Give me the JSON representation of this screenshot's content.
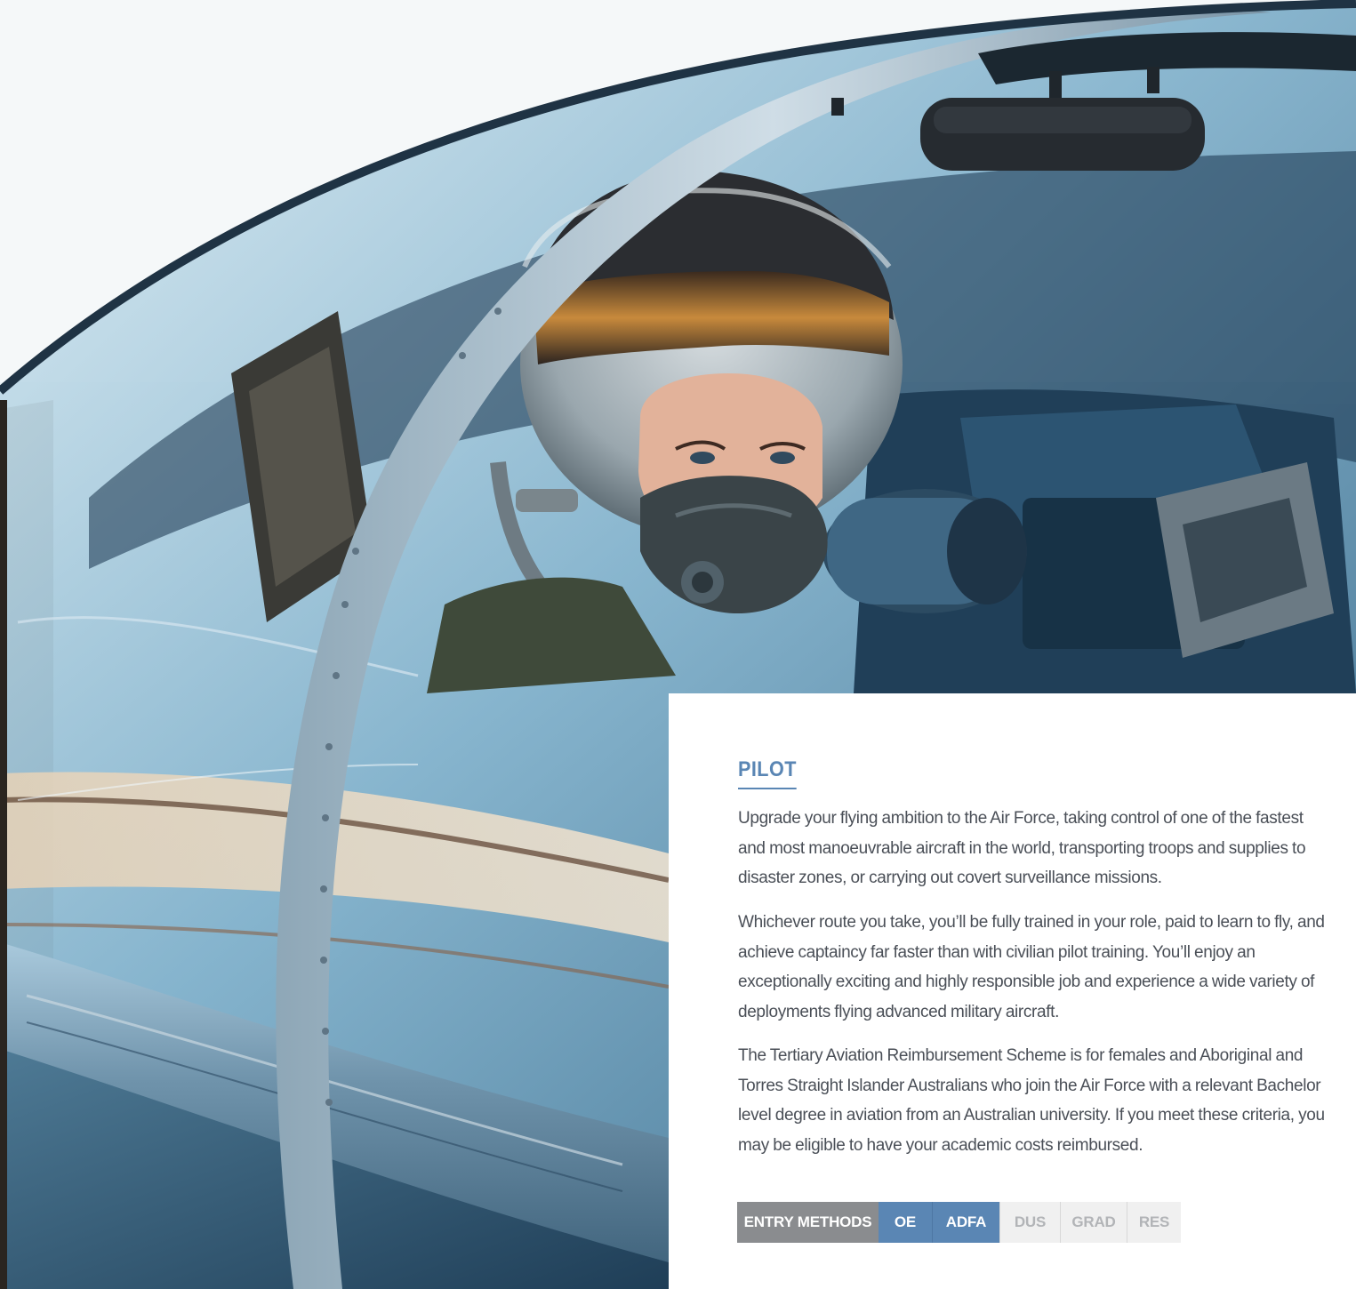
{
  "hero": {
    "alt": "Pilot wearing a flight helmet, visor and oxygen mask, seated in a fighter jet cockpit beneath a clear canopy"
  },
  "pilot": {
    "title": "PILOT",
    "paragraphs": [
      "Upgrade your flying ambition to the Air Force, taking control of one of the fastest and most manoeuvrable aircraft in the world, transporting troops and supplies to disaster zones, or carrying out covert surveillance missions.",
      "Whichever route you take, you’ll be fully trained in your role, paid to learn to fly, and achieve captaincy far faster than with civilian pilot training. You’ll enjoy an exceptionally exciting and highly responsible job and experience a wide variety of deployments flying advanced military aircraft.",
      "The Tertiary Aviation Reimbursement Scheme is for females and Aboriginal and Torres Straight Islander Australians who join the Air Force with a relevant Bachelor level degree in aviation from an Australian university. If you meet these criteria, you may be eligible to have your academic costs reimbursed."
    ]
  },
  "entry_methods": {
    "label": "ENTRY METHODS",
    "items": [
      {
        "label": "OE",
        "active": true
      },
      {
        "label": "ADFA",
        "active": true
      },
      {
        "label": "DUS",
        "active": false
      },
      {
        "label": "GRAD",
        "active": false
      },
      {
        "label": "RES",
        "active": false
      }
    ]
  },
  "colors": {
    "accent": "#5a86b4",
    "label_bg": "#8a8c8f",
    "inactive_bg": "#f0f0f0",
    "inactive_text": "#b2b4b7",
    "body_text": "#4a4f57"
  }
}
